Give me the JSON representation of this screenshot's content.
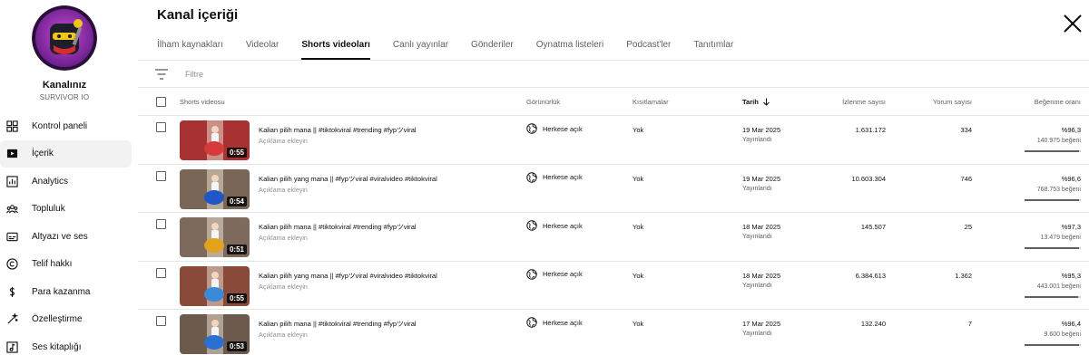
{
  "channel": {
    "name": "Kanalınız",
    "handle": "SURVIVOR IO"
  },
  "nav": [
    {
      "label": "Kontrol paneli",
      "icon": "dashboard-icon"
    },
    {
      "label": "İçerik",
      "icon": "content-icon"
    },
    {
      "label": "Analytics",
      "icon": "analytics-icon"
    },
    {
      "label": "Topluluk",
      "icon": "community-icon"
    },
    {
      "label": "Altyazı ve ses",
      "icon": "subtitles-icon"
    },
    {
      "label": "Telif hakkı",
      "icon": "copyright-icon"
    },
    {
      "label": "Para kazanma",
      "icon": "monetization-icon"
    },
    {
      "label": "Özelleştirme",
      "icon": "customization-icon"
    },
    {
      "label": "Ses kitaplığı",
      "icon": "audio-library-icon"
    }
  ],
  "header": {
    "title": "Kanal içeriği"
  },
  "tabs": [
    "İlham kaynakları",
    "Videolar",
    "Shorts videoları",
    "Canlı yayınlar",
    "Gönderiler",
    "Oynatma listeleri",
    "Podcast'ler",
    "Tanıtımlar"
  ],
  "active_tab": "Shorts videoları",
  "filter": {
    "placeholder": "Filtre",
    "value": ""
  },
  "columns": {
    "video": "Shorts videosu",
    "visibility": "Görünürlük",
    "restrictions": "Kısıtlamalar",
    "date": "Tarih",
    "views": "İzlenme sayısı",
    "comments": "Yorum sayısı",
    "likes": "Beğenme oranı"
  },
  "rows": [
    {
      "duration": "0:55",
      "title": "Kalian pilih mana || #tiktokviral #trending #fypツviral",
      "description": "Açıklama ekleyin",
      "visibility": "Herkese açık",
      "restrictions": "Yok",
      "date": "19 Mar 2025",
      "date_status": "Yayınlandı",
      "views": "1.631.172",
      "comments": "334",
      "like_pct": "%96,3",
      "like_count": "140.975 beğeni",
      "like_ratio": 0.963,
      "thumb_bg": "#a83232",
      "thumb_accent": "#d63a3a"
    },
    {
      "duration": "0:54",
      "title": "Kalian pilih yang mana || #fypツviral #viralvideo #tiktokviral",
      "description": "Açıklama ekleyin",
      "visibility": "Herkese açık",
      "restrictions": "Yok",
      "date": "19 Mar 2025",
      "date_status": "Yayınlandı",
      "views": "10.603.304",
      "comments": "746",
      "like_pct": "%96,6",
      "like_count": "768.753 beğeni",
      "like_ratio": 0.966,
      "thumb_bg": "#7a6656",
      "thumb_accent": "#1f57c4"
    },
    {
      "duration": "0:51",
      "title": "Kalian pilih mana || #tiktokviral #trending #fypツviral",
      "description": "Açıklama ekleyin",
      "visibility": "Herkese açık",
      "restrictions": "Yok",
      "date": "18 Mar 2025",
      "date_status": "Yayınlandı",
      "views": "145.507",
      "comments": "25",
      "like_pct": "%97,3",
      "like_count": "13.479 beğeni",
      "like_ratio": 0.973,
      "thumb_bg": "#7d6a5c",
      "thumb_accent": "#e4a11b"
    },
    {
      "duration": "0:55",
      "title": "Kalian pilih yang mana || #fypツviral #viralvideo #tiktokviral",
      "description": "Açıklama ekleyin",
      "visibility": "Herkese açık",
      "restrictions": "Yok",
      "date": "18 Mar 2025",
      "date_status": "Yayınlandı",
      "views": "6.384.613",
      "comments": "1.362",
      "like_pct": "%95,3",
      "like_count": "443.001 beğeni",
      "like_ratio": 0.953,
      "thumb_bg": "#8a4a3a",
      "thumb_accent": "#3b8ad8"
    },
    {
      "duration": "0:53",
      "title": "Kalian pilih mana || #tiktokviral #trending #fypツviral",
      "description": "Açıklama ekleyin",
      "visibility": "Herkese açık",
      "restrictions": "Yok",
      "date": "17 Mar 2025",
      "date_status": "Yayınlandı",
      "views": "132.240",
      "comments": "7",
      "like_pct": "%96,4",
      "like_count": "9.600 beğeni",
      "like_ratio": 0.964,
      "thumb_bg": "#6c5a4c",
      "thumb_accent": "#2a6fd1"
    }
  ]
}
